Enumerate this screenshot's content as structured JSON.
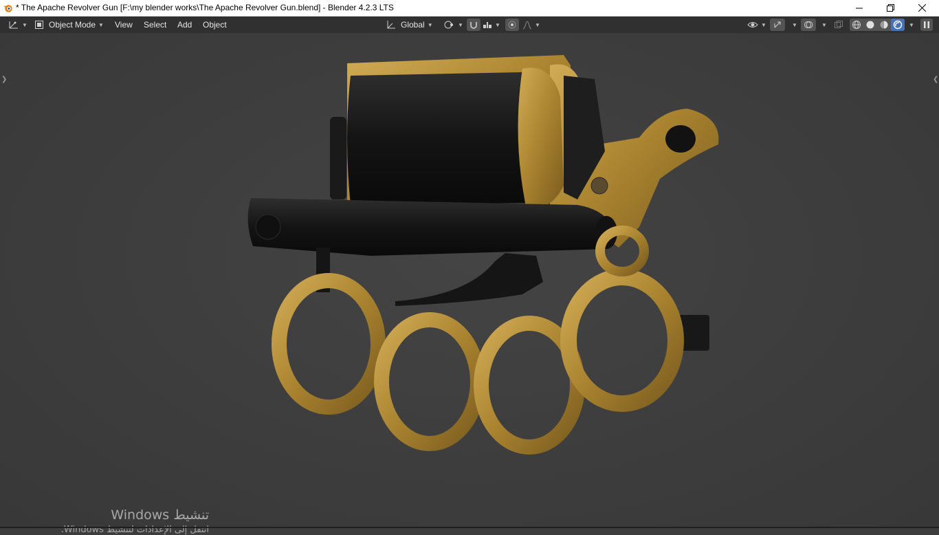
{
  "window": {
    "title": "* The Apache Revolver Gun [F:\\my blender works\\The Apache Revolver Gun.blend] - Blender 4.2.3 LTS",
    "icons": [
      "blender-logo-icon",
      "minimize-icon",
      "restore-icon",
      "close-icon"
    ]
  },
  "header": {
    "mode_label": "Object Mode",
    "menus": [
      "View",
      "Select",
      "Add",
      "Object"
    ],
    "transform_orientation": "Global",
    "icons": [
      "editor-type-icon",
      "object-mode-icon",
      "orientation-icon",
      "pivot-icon",
      "snap-icon",
      "snap-increment-icon",
      "proportional-edit-icon",
      "falloff-icon",
      "visibility-icon",
      "gizmo-icon",
      "overlay-icon",
      "xray-icon",
      "wireframe-shading-icon",
      "solid-shading-icon",
      "material-shading-icon",
      "rendered-shading-icon",
      "pause-icon"
    ],
    "active_shading": "rendered"
  },
  "viewport": {
    "background_color": "#3d3d3d",
    "model": "revolver with brass knuckles",
    "brass_color": "#b08a36",
    "steel_color": "#1c1c1c"
  },
  "watermark": {
    "title": "تنشيط Windows",
    "subtitle": "انتقل إلى الإعدادات لتنشيط Windows."
  }
}
